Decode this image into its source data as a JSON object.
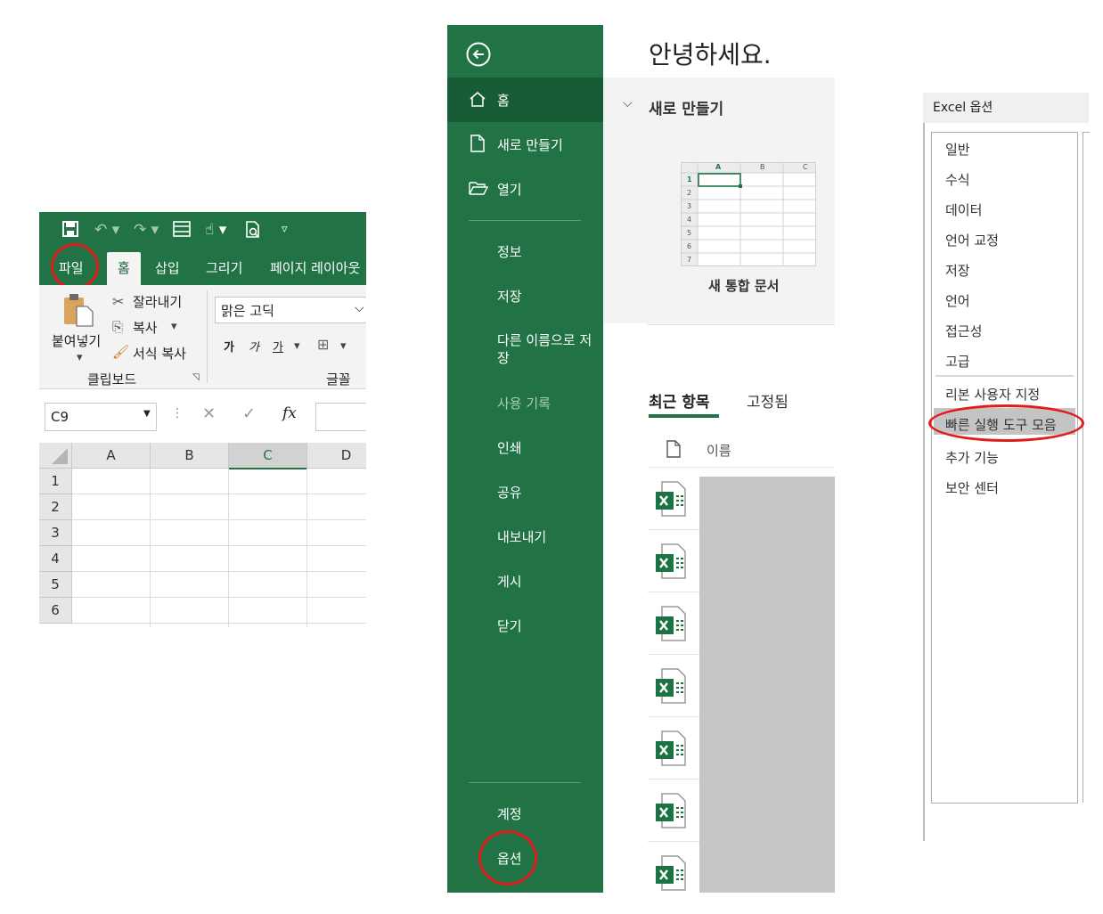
{
  "excel": {
    "tabs": [
      "파일",
      "홈",
      "삽입",
      "그리기",
      "페이지 레이아웃"
    ],
    "clipboard": {
      "paste": "붙여넣기",
      "cut": "잘라내기",
      "copy": "복사",
      "format_painter": "서식 복사",
      "group": "클립보드"
    },
    "font": {
      "name": "맑은 고딕",
      "bold": "가",
      "italic": "가",
      "underline": "가",
      "group": "글꼴"
    },
    "name_box": "C9",
    "fx": "fx",
    "columns": [
      "A",
      "B",
      "C",
      "D"
    ],
    "rows": [
      "1",
      "2",
      "3",
      "4",
      "5",
      "6"
    ]
  },
  "backstage": {
    "greeting": "안녕하세요.",
    "nav_top": [
      {
        "label": "홈",
        "icon": "home-icon"
      },
      {
        "label": "새로 만들기",
        "icon": "new-file-icon"
      },
      {
        "label": "열기",
        "icon": "open-folder-icon"
      }
    ],
    "nav_mid": [
      "정보",
      "저장",
      "다른 이름으로 저장",
      "사용 기록",
      "인쇄",
      "공유",
      "내보내기",
      "게시",
      "닫기"
    ],
    "nav_bottom": [
      "계정",
      "옵션"
    ],
    "new_section": "새로 만들기",
    "template": {
      "label": "새 통합 문서",
      "columns": [
        "A",
        "B",
        "C"
      ],
      "rows": [
        "1",
        "2",
        "3",
        "4",
        "5",
        "6",
        "7"
      ]
    },
    "recent_tabs": [
      "최근 항목",
      "고정됨"
    ],
    "name_header": "이름"
  },
  "options": {
    "title": "Excel 옵션",
    "items": [
      "일반",
      "수식",
      "데이터",
      "언어 교정",
      "저장",
      "언어",
      "접근성",
      "고급",
      "리본 사용자 지정",
      "빠른 실행 도구 모음",
      "추가 기능",
      "보안 센터"
    ]
  },
  "colors": {
    "excel_green": "#217346",
    "excel_dark_green": "#185c37",
    "highlight": "#e21b1b"
  }
}
